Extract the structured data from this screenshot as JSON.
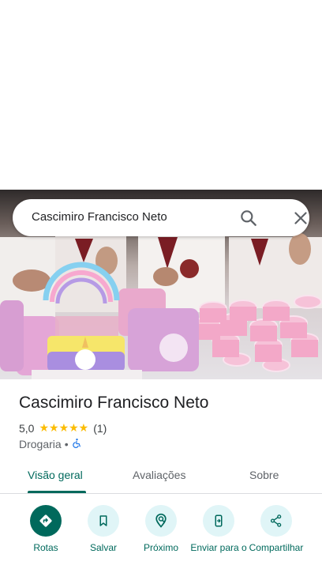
{
  "search": {
    "query": "Cascimiro Francisco Neto"
  },
  "place": {
    "title": "Cascimiro Francisco Neto",
    "rating": "5,0",
    "stars": "★★★★★",
    "review_count": "(1)",
    "category": "Drogaria",
    "separator": "•"
  },
  "tabs": [
    {
      "label": "Visão geral",
      "active": true
    },
    {
      "label": "Avaliações",
      "active": false
    },
    {
      "label": "Sobre",
      "active": false
    }
  ],
  "actions": [
    {
      "label": "Rotas",
      "icon": "directions-icon"
    },
    {
      "label": "Salvar",
      "icon": "bookmark-icon"
    },
    {
      "label": "Próximo",
      "icon": "nearby-icon"
    },
    {
      "label": "Enviar para o",
      "icon": "send-to-phone-icon"
    },
    {
      "label": "Compartilhar",
      "icon": "share-icon"
    }
  ],
  "colors": {
    "accent": "#00695c",
    "star": "#fbbc04",
    "action_bg": "#e0f5f7"
  }
}
